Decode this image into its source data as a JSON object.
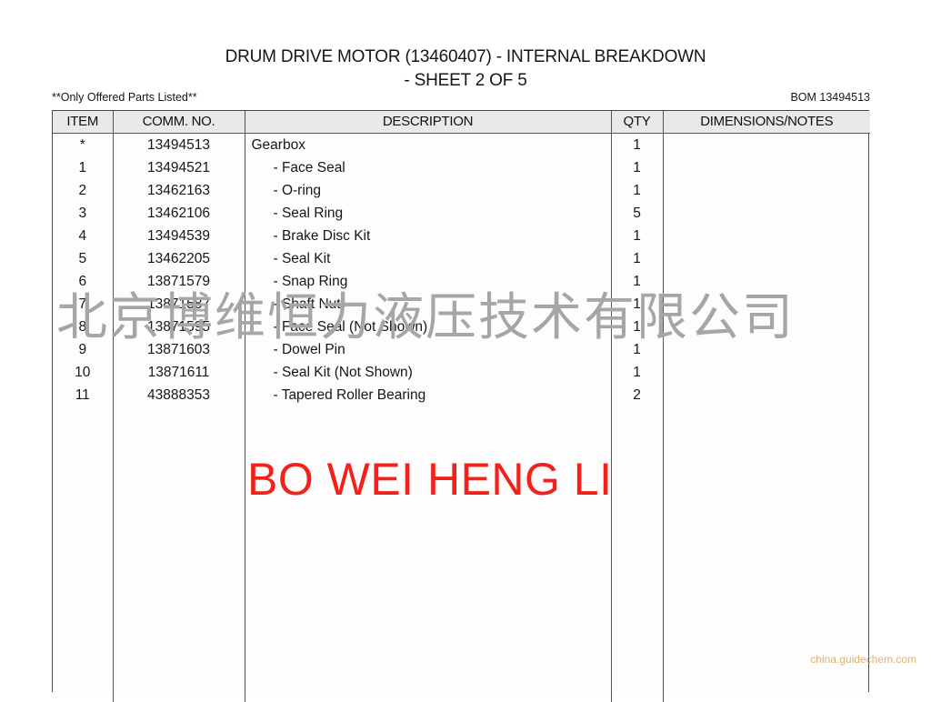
{
  "document": {
    "title_line_1": "DRUM DRIVE MOTOR (13460407) - INTERNAL BREAKDOWN",
    "title_line_2": "- SHEET 2 OF 5",
    "note_left": "**Only Offered Parts Listed**",
    "bom_label": "BOM 13494513"
  },
  "table": {
    "headers": {
      "item": "ITEM",
      "comm_no": "COMM. NO.",
      "description": "DESCRIPTION",
      "qty": "QTY",
      "dimensions": "DIMENSIONS/NOTES"
    },
    "rows": [
      {
        "item": "*",
        "comm_no": "13494513",
        "description": "Gearbox",
        "indented": false,
        "qty": "1",
        "dimensions": ""
      },
      {
        "item": "1",
        "comm_no": "13494521",
        "description": "- Face Seal",
        "indented": true,
        "qty": "1",
        "dimensions": ""
      },
      {
        "item": "2",
        "comm_no": "13462163",
        "description": "- O-ring",
        "indented": true,
        "qty": "1",
        "dimensions": ""
      },
      {
        "item": "3",
        "comm_no": "13462106",
        "description": "- Seal Ring",
        "indented": true,
        "qty": "5",
        "dimensions": ""
      },
      {
        "item": "4",
        "comm_no": "13494539",
        "description": "- Brake Disc Kit",
        "indented": true,
        "qty": "1",
        "dimensions": ""
      },
      {
        "item": "5",
        "comm_no": "13462205",
        "description": "- Seal Kit",
        "indented": true,
        "qty": "1",
        "dimensions": ""
      },
      {
        "item": "6",
        "comm_no": "13871579",
        "description": "- Snap Ring",
        "indented": true,
        "qty": "1",
        "dimensions": ""
      },
      {
        "item": "7",
        "comm_no": "13871587",
        "description": "- Shaft Nut",
        "indented": true,
        "qty": "1",
        "dimensions": ""
      },
      {
        "item": "8",
        "comm_no": "13871595",
        "description": "- Face Seal (Not Shown)",
        "indented": true,
        "qty": "1",
        "dimensions": ""
      },
      {
        "item": "9",
        "comm_no": "13871603",
        "description": "- Dowel Pin",
        "indented": true,
        "qty": "1",
        "dimensions": ""
      },
      {
        "item": "10",
        "comm_no": "13871611",
        "description": "- Seal Kit (Not Shown)",
        "indented": true,
        "qty": "1",
        "dimensions": ""
      },
      {
        "item": "11",
        "comm_no": "43888353",
        "description": "- Tapered Roller Bearing",
        "indented": true,
        "qty": "2",
        "dimensions": ""
      }
    ],
    "empty_row_count": 13
  },
  "watermarks": {
    "brand_red": "BO WEI HENG LI",
    "brand_red_color": "#f4211a",
    "company_chinese": "北京博维恒力液压技术有限公司",
    "company_chinese_color": "#a6a6a6",
    "site": "china.guidechem.com",
    "site_color": "#e0b070"
  },
  "colors": {
    "header_background": "#e9e9e9",
    "border": "#555555",
    "text": "#161616",
    "page_background": "#ffffff"
  }
}
